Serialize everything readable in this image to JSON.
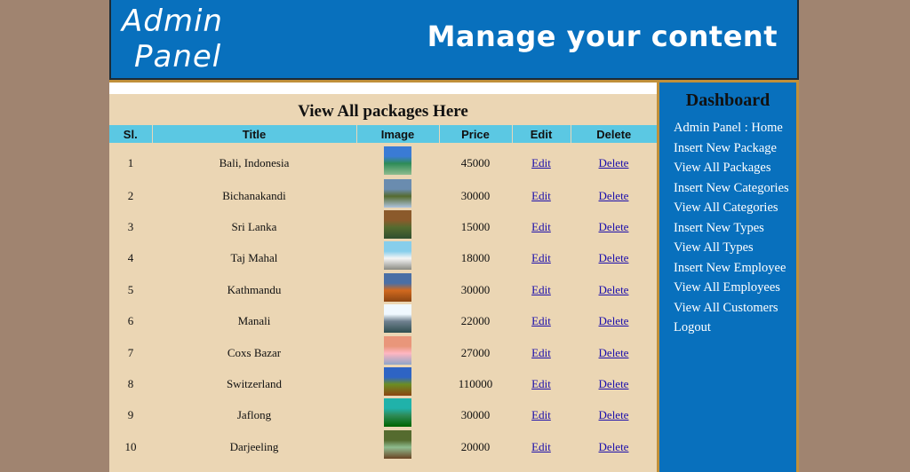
{
  "header": {
    "logo_line1": "Admin",
    "logo_line2": "Panel",
    "tagline": "Manage your content"
  },
  "main": {
    "heading": "View All packages Here",
    "columns": [
      "Sl.",
      "Title",
      "Image",
      "Price",
      "Edit",
      "Delete"
    ],
    "rows": [
      {
        "sl": "1",
        "title": "Bali, Indonesia",
        "price": "45000",
        "edit": "Edit",
        "delete": "Delete"
      },
      {
        "sl": "2",
        "title": "Bichanakandi",
        "price": "30000",
        "edit": "Edit",
        "delete": "Delete"
      },
      {
        "sl": "3",
        "title": "Sri Lanka",
        "price": "15000",
        "edit": "Edit",
        "delete": "Delete"
      },
      {
        "sl": "4",
        "title": "Taj Mahal",
        "price": "18000",
        "edit": "Edit",
        "delete": "Delete"
      },
      {
        "sl": "5",
        "title": "Kathmandu",
        "price": "30000",
        "edit": "Edit",
        "delete": "Delete"
      },
      {
        "sl": "6",
        "title": "Manali",
        "price": "22000",
        "edit": "Edit",
        "delete": "Delete"
      },
      {
        "sl": "7",
        "title": "Coxs Bazar",
        "price": "27000",
        "edit": "Edit",
        "delete": "Delete"
      },
      {
        "sl": "8",
        "title": "Switzerland",
        "price": "110000",
        "edit": "Edit",
        "delete": "Delete"
      },
      {
        "sl": "9",
        "title": "Jaflong",
        "price": "30000",
        "edit": "Edit",
        "delete": "Delete"
      },
      {
        "sl": "10",
        "title": "Darjeeling",
        "price": "20000",
        "edit": "Edit",
        "delete": "Delete"
      }
    ]
  },
  "sidebar": {
    "title": "Dashboard",
    "items": [
      "Admin Panel : Home",
      "Insert New Package",
      "View All Packages",
      "Insert New Categories",
      "View All Categories",
      "Insert New Types",
      "View All Types",
      "Insert New Employee",
      "View All Employees",
      "View All Customers",
      "Logout"
    ]
  },
  "colors": {
    "header_bg": "#0870bd",
    "page_bg": "#a08470",
    "content_bg": "#ebd6b4",
    "table_header_bg": "#5bc8e3",
    "border_accent": "#c0903a"
  }
}
